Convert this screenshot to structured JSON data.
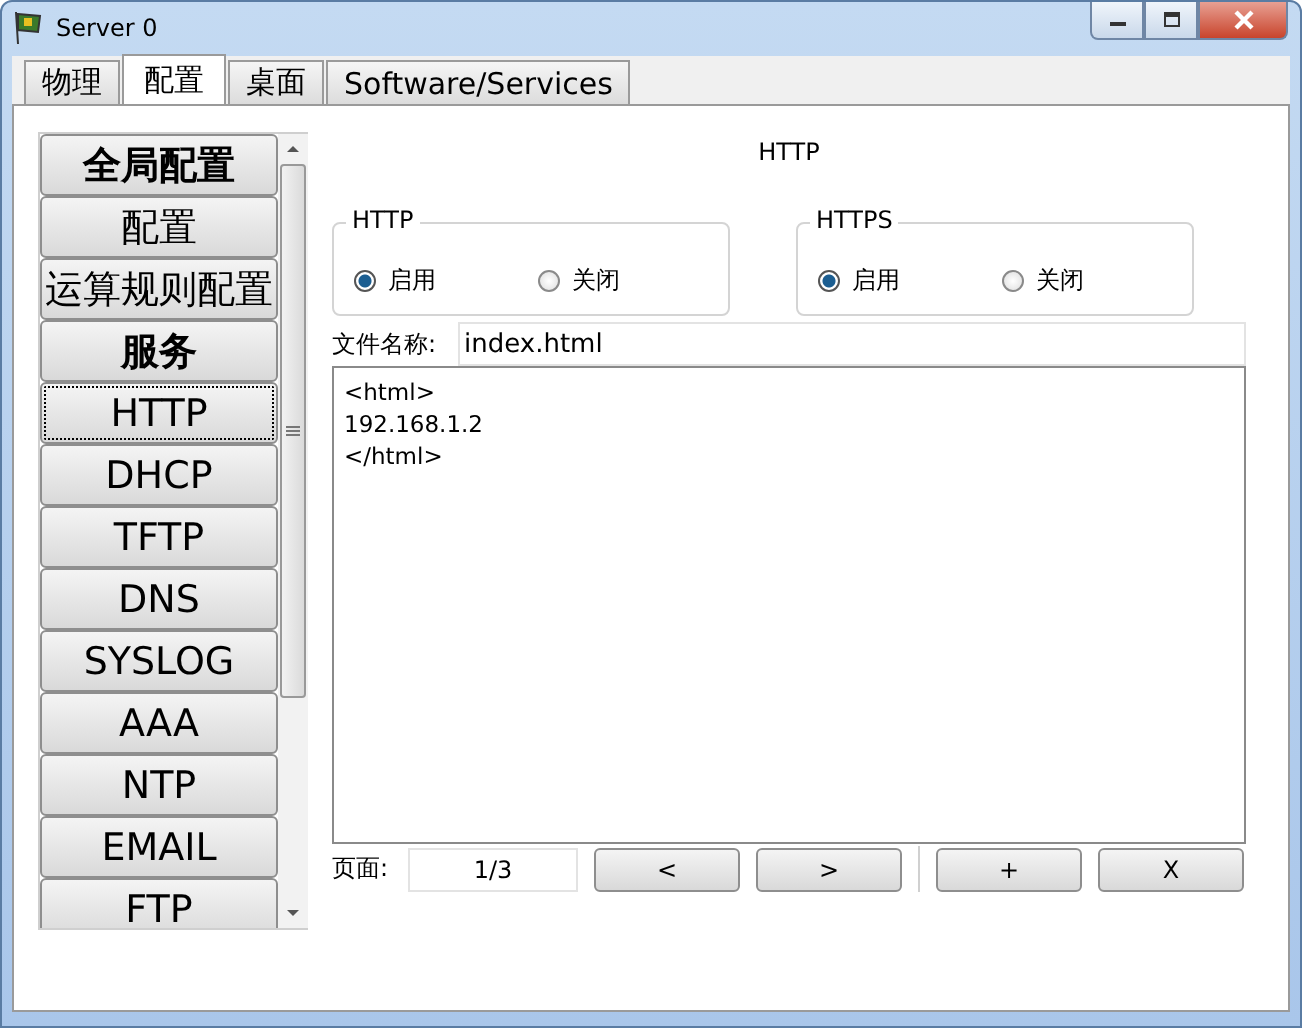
{
  "window": {
    "title": "Server 0"
  },
  "tabs": [
    {
      "label": "物理",
      "selected": false
    },
    {
      "label": "配置",
      "selected": true
    },
    {
      "label": "桌面",
      "selected": false
    },
    {
      "label": "Software/Services",
      "selected": false
    }
  ],
  "sidebar": {
    "items": [
      {
        "label": "全局配置",
        "kind": "header",
        "selected": false
      },
      {
        "label": "配置",
        "kind": "item",
        "selected": false
      },
      {
        "label": "运算规则配置",
        "kind": "item",
        "selected": false
      },
      {
        "label": "服务",
        "kind": "header",
        "selected": false
      },
      {
        "label": "HTTP",
        "kind": "item",
        "selected": true
      },
      {
        "label": "DHCP",
        "kind": "item",
        "selected": false
      },
      {
        "label": "TFTP",
        "kind": "item",
        "selected": false
      },
      {
        "label": "DNS",
        "kind": "item",
        "selected": false
      },
      {
        "label": "SYSLOG",
        "kind": "item",
        "selected": false
      },
      {
        "label": "AAA",
        "kind": "item",
        "selected": false
      },
      {
        "label": "NTP",
        "kind": "item",
        "selected": false
      },
      {
        "label": "EMAIL",
        "kind": "item",
        "selected": false
      },
      {
        "label": "FTP",
        "kind": "item",
        "selected": false
      }
    ]
  },
  "service": {
    "title": "HTTP",
    "groups": [
      {
        "title": "HTTP",
        "options": [
          {
            "label": "启用",
            "selected": true
          },
          {
            "label": "关闭",
            "selected": false
          }
        ]
      },
      {
        "title": "HTTPS",
        "options": [
          {
            "label": "启用",
            "selected": true
          },
          {
            "label": "关闭",
            "selected": false
          }
        ]
      }
    ],
    "file_name": {
      "label": "文件名称:",
      "value": "index.html"
    },
    "content": {
      "lines": [
        "<html>",
        "192.168.1.2",
        "</html>"
      ]
    },
    "pager": {
      "label": "页面:",
      "value": "1/3",
      "buttons": [
        "<",
        ">",
        "+",
        "X"
      ]
    }
  }
}
